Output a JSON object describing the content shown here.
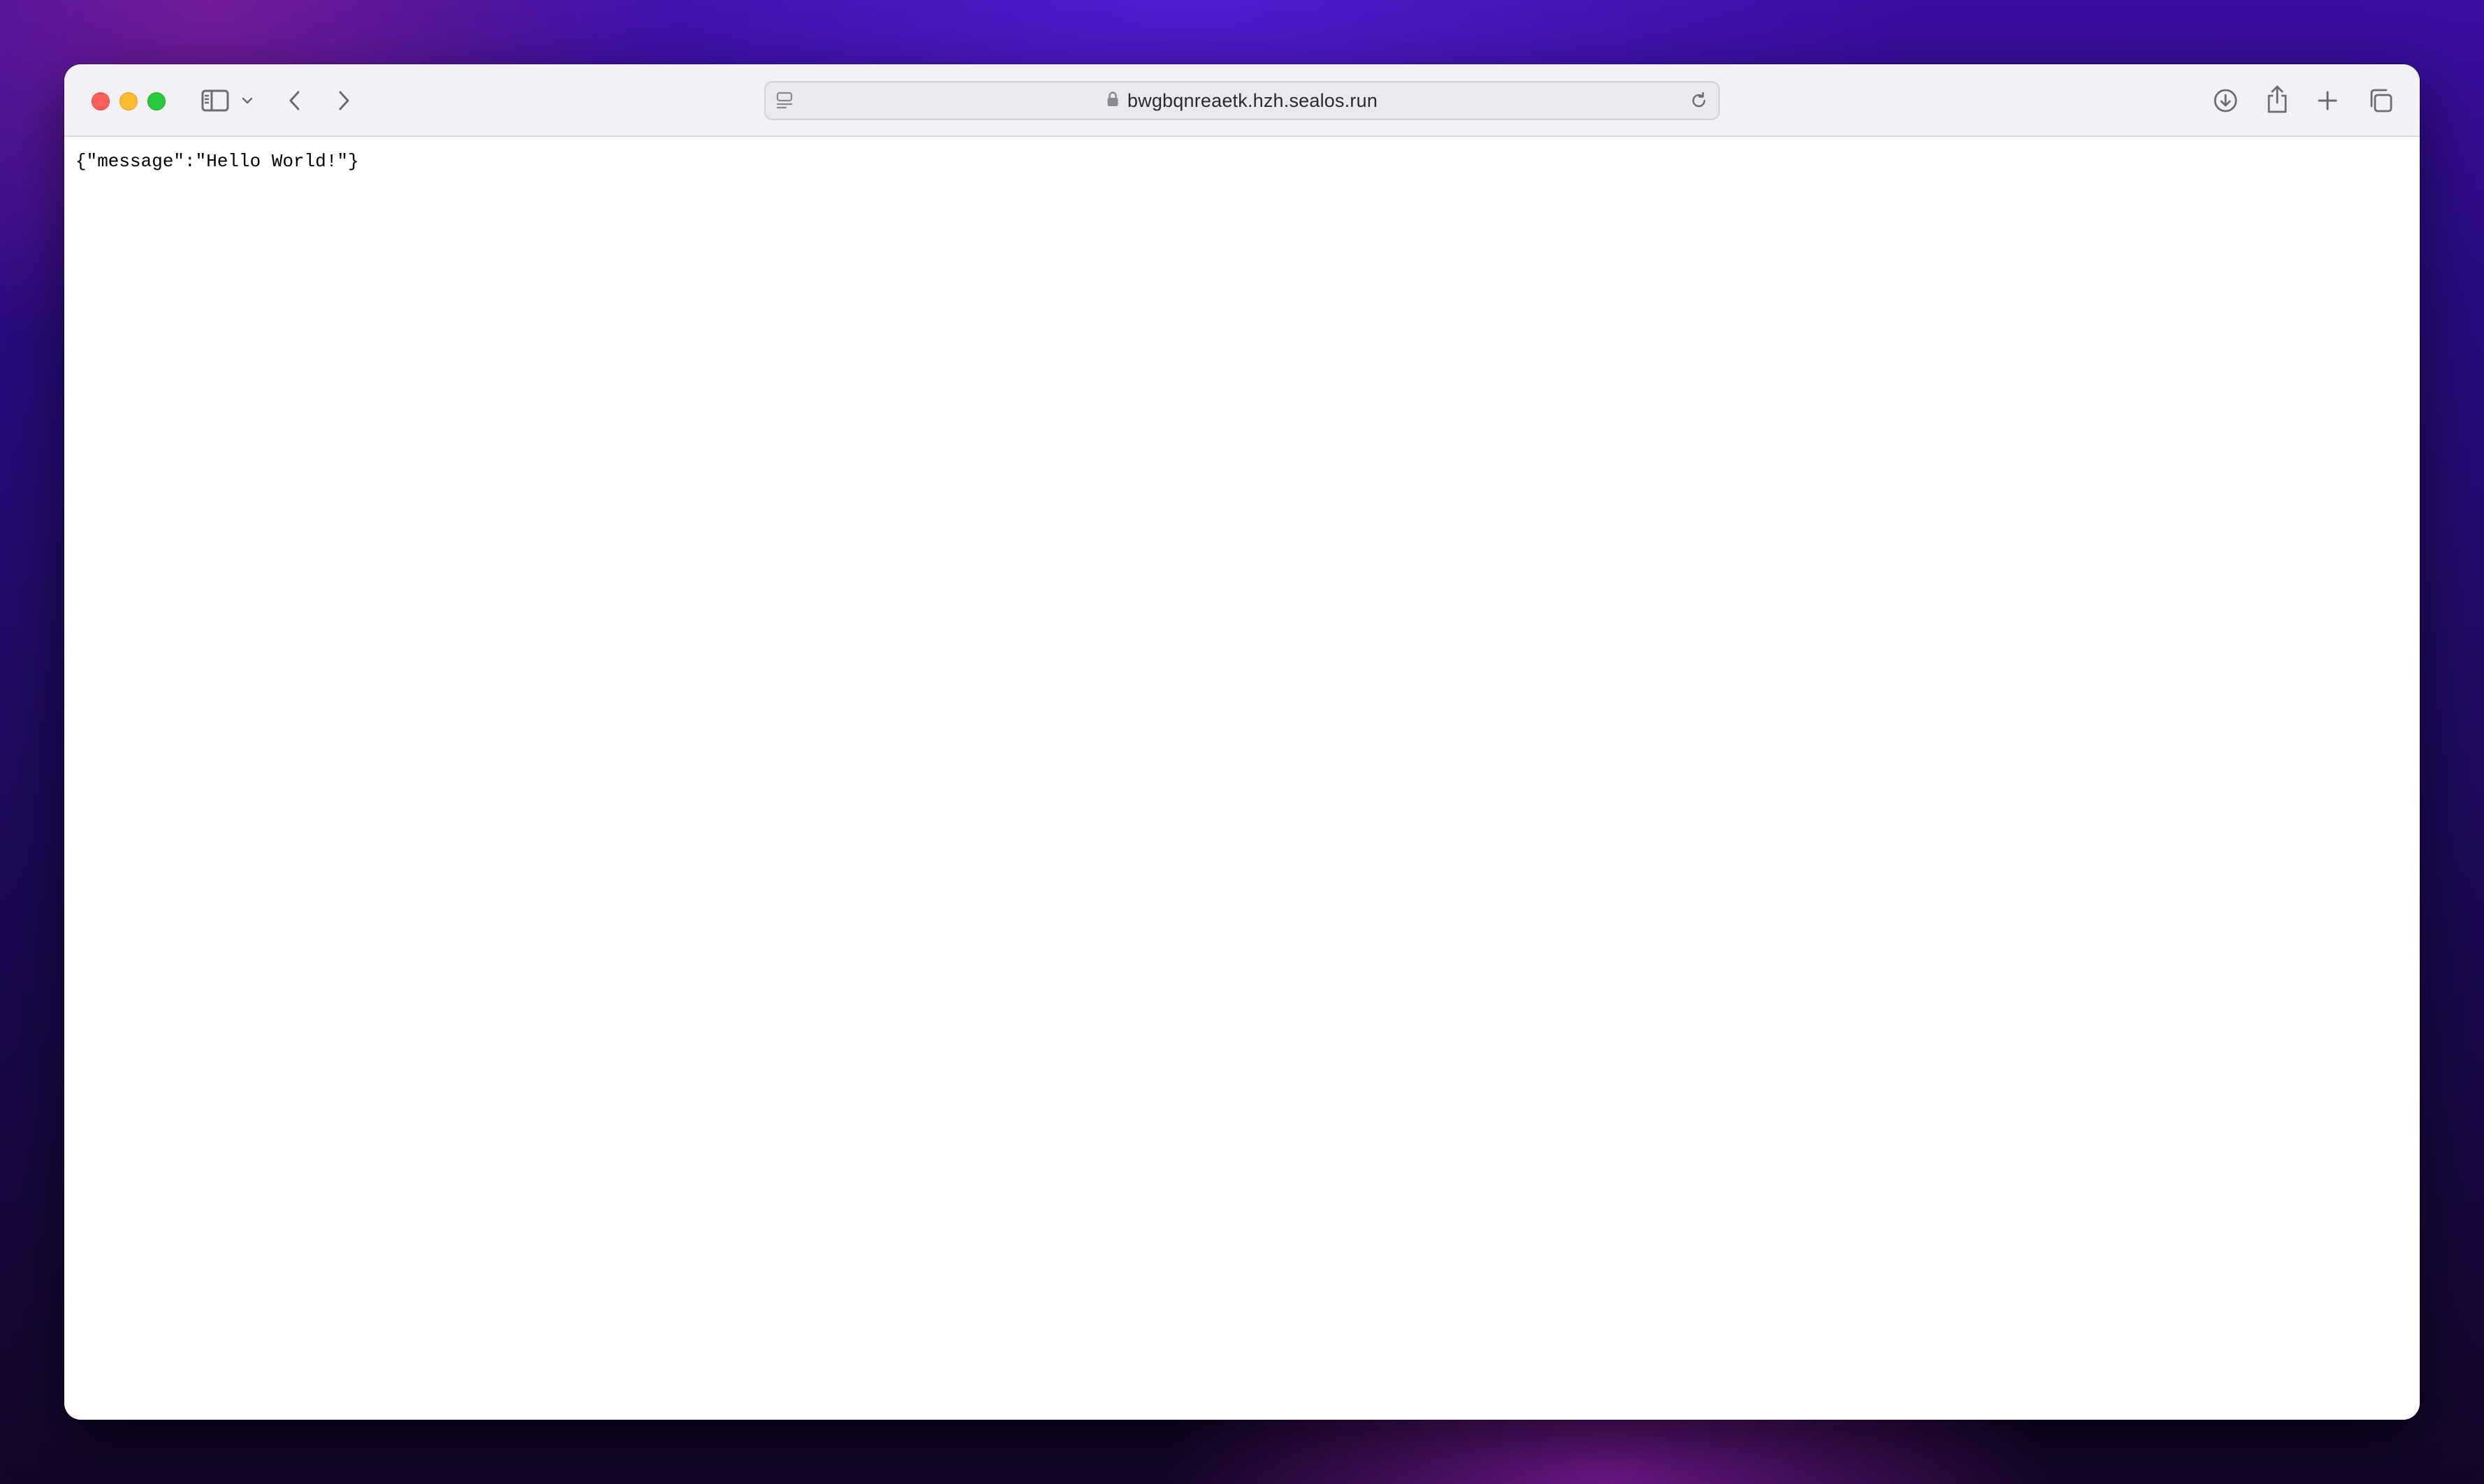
{
  "browser": {
    "address_bar": {
      "url": "bwgbqnreaetk.hzh.sealos.run",
      "secure": true
    },
    "toolbar": {
      "icons": [
        "sidebar-icon",
        "chevron-down-icon",
        "back-icon",
        "forward-icon",
        "downloads-icon",
        "share-icon",
        "new-tab-icon",
        "tab-overview-icon"
      ]
    }
  },
  "page": {
    "body_text": "{\"message\":\"Hello World!\"}"
  },
  "colors": {
    "close": "#fe5f57",
    "minimize": "#febc2e",
    "maximize": "#28c840",
    "toolbar_bg": "#f3f1f6",
    "page_bg": "#ffffff"
  }
}
